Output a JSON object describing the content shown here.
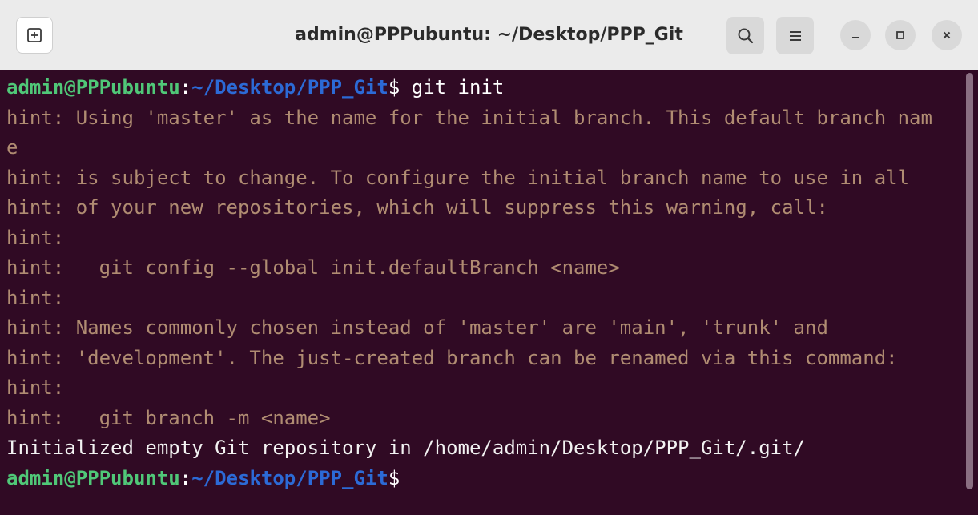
{
  "window": {
    "title": "admin@PPPubuntu: ~/Desktop/PPP_Git",
    "colors": {
      "terminal_bg": "#300a24",
      "titlebar_bg": "#ebebeb",
      "prompt_user": "#50c878",
      "prompt_path": "#2c6ad6",
      "hint_text": "#b08c72"
    },
    "icons": {
      "new_tab": "new-tab-icon",
      "search": "search-icon",
      "menu": "hamburger-menu-icon",
      "minimize": "minimize-icon",
      "maximize": "maximize-icon",
      "close": "close-icon"
    }
  },
  "terminal": {
    "prompt1": {
      "user": "admin@PPPubuntu",
      "colon": ":",
      "path": "~/Desktop/PPP_Git",
      "dollar": "$",
      "command": " git init"
    },
    "output": [
      "hint: Using 'master' as the name for the initial branch. This default branch nam",
      "e",
      "hint: is subject to change. To configure the initial branch name to use in all",
      "hint: of your new repositories, which will suppress this warning, call:",
      "hint:",
      "hint:   git config --global init.defaultBranch <name>",
      "hint:",
      "hint: Names commonly chosen instead of 'master' are 'main', 'trunk' and",
      "hint: 'development'. The just-created branch can be renamed via this command:",
      "hint:",
      "hint:   git branch -m <name>"
    ],
    "result": "Initialized empty Git repository in /home/admin/Desktop/PPP_Git/.git/",
    "prompt2": {
      "user": "admin@PPPubuntu",
      "colon": ":",
      "path": "~/Desktop/PPP_Git",
      "dollar": "$"
    }
  }
}
